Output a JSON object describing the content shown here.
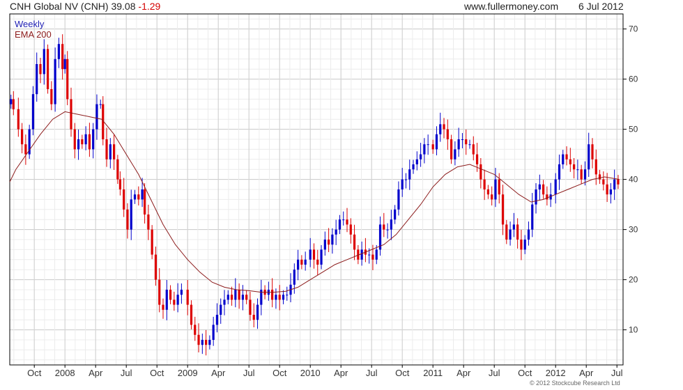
{
  "header": {
    "title": "CNH Global NV (CNH)",
    "last": "39.08",
    "change": "-1.29",
    "site": "www.fullermoney.com",
    "date": "6 Jul 2012"
  },
  "footer": {
    "copyright": "© 2012 Stockcube Research Ltd"
  },
  "colors": {
    "up": "#0000cc",
    "down": "#dd0000",
    "ema": "#8b1a1a",
    "grid": "#d6d6d6",
    "axis": "#000000"
  },
  "chart_data": {
    "type": "candlestick",
    "legend": [
      {
        "name": "Weekly",
        "color": "#1f1fb4"
      },
      {
        "name": "EMA 200",
        "color": "#8b1a1a"
      }
    ],
    "legend_position": "top-left",
    "yaxis_position": "right",
    "ylim": [
      3,
      73
    ],
    "yticks": [
      10,
      20,
      30,
      40,
      50,
      60,
      70
    ],
    "xlim": [
      2007.55,
      2012.55
    ],
    "xticks": [
      {
        "label": "Oct",
        "x": 2007.75
      },
      {
        "label": "2008",
        "x": 2008.0
      },
      {
        "label": "Apr",
        "x": 2008.25
      },
      {
        "label": "Jul",
        "x": 2008.5
      },
      {
        "label": "Oct",
        "x": 2008.75
      },
      {
        "label": "2009",
        "x": 2009.0
      },
      {
        "label": "Apr",
        "x": 2009.25
      },
      {
        "label": "Jul",
        "x": 2009.5
      },
      {
        "label": "Oct",
        "x": 2009.75
      },
      {
        "label": "2010",
        "x": 2010.0
      },
      {
        "label": "Apr",
        "x": 2010.25
      },
      {
        "label": "Jul",
        "x": 2010.5
      },
      {
        "label": "Oct",
        "x": 2010.75
      },
      {
        "label": "2011",
        "x": 2011.0
      },
      {
        "label": "Apr",
        "x": 2011.25
      },
      {
        "label": "Jul",
        "x": 2011.5
      },
      {
        "label": "Oct",
        "x": 2011.75
      },
      {
        "label": "2012",
        "x": 2012.0
      },
      {
        "label": "Apr",
        "x": 2012.25
      },
      {
        "label": "Jul",
        "x": 2012.5
      }
    ],
    "grid": true,
    "closes": [
      [
        2007.56,
        56
      ],
      [
        2007.58,
        54
      ],
      [
        2007.62,
        50
      ],
      [
        2007.65,
        47
      ],
      [
        2007.68,
        45
      ],
      [
        2007.71,
        50
      ],
      [
        2007.74,
        57
      ],
      [
        2007.77,
        63
      ],
      [
        2007.8,
        61
      ],
      [
        2007.83,
        66
      ],
      [
        2007.86,
        58
      ],
      [
        2007.89,
        55
      ],
      [
        2007.92,
        64
      ],
      [
        2007.95,
        67
      ],
      [
        2007.98,
        62
      ],
      [
        2008.0,
        64
      ],
      [
        2008.02,
        56
      ],
      [
        2008.05,
        50
      ],
      [
        2008.08,
        46
      ],
      [
        2008.11,
        48
      ],
      [
        2008.14,
        47
      ],
      [
        2008.17,
        49
      ],
      [
        2008.2,
        46
      ],
      [
        2008.23,
        50
      ],
      [
        2008.26,
        55
      ],
      [
        2008.29,
        55
      ],
      [
        2008.31,
        48
      ],
      [
        2008.34,
        44
      ],
      [
        2008.37,
        47
      ],
      [
        2008.4,
        44
      ],
      [
        2008.43,
        40
      ],
      [
        2008.45,
        38
      ],
      [
        2008.48,
        34
      ],
      [
        2008.51,
        30
      ],
      [
        2008.54,
        36
      ],
      [
        2008.57,
        37
      ],
      [
        2008.6,
        36
      ],
      [
        2008.63,
        38
      ],
      [
        2008.65,
        33
      ],
      [
        2008.68,
        30
      ],
      [
        2008.71,
        25
      ],
      [
        2008.74,
        20
      ],
      [
        2008.77,
        15
      ],
      [
        2008.8,
        14
      ],
      [
        2008.83,
        18
      ],
      [
        2008.86,
        16
      ],
      [
        2008.89,
        15
      ],
      [
        2008.92,
        17
      ],
      [
        2008.95,
        18
      ],
      [
        2009.0,
        15
      ],
      [
        2009.03,
        11
      ],
      [
        2009.06,
        9
      ],
      [
        2009.09,
        7
      ],
      [
        2009.12,
        8
      ],
      [
        2009.15,
        7
      ],
      [
        2009.18,
        8
      ],
      [
        2009.21,
        11
      ],
      [
        2009.24,
        13
      ],
      [
        2009.27,
        15
      ],
      [
        2009.3,
        16
      ],
      [
        2009.33,
        17
      ],
      [
        2009.36,
        16
      ],
      [
        2009.39,
        18
      ],
      [
        2009.42,
        16
      ],
      [
        2009.45,
        17
      ],
      [
        2009.48,
        16
      ],
      [
        2009.51,
        13
      ],
      [
        2009.54,
        12
      ],
      [
        2009.57,
        15
      ],
      [
        2009.6,
        18
      ],
      [
        2009.63,
        17
      ],
      [
        2009.66,
        18
      ],
      [
        2009.69,
        16
      ],
      [
        2009.72,
        17
      ],
      [
        2009.75,
        16
      ],
      [
        2009.78,
        17
      ],
      [
        2009.81,
        17
      ],
      [
        2009.84,
        19
      ],
      [
        2009.87,
        22
      ],
      [
        2009.9,
        24
      ],
      [
        2009.93,
        23
      ],
      [
        2009.96,
        24
      ],
      [
        2010.0,
        26
      ],
      [
        2010.03,
        24
      ],
      [
        2010.06,
        23
      ],
      [
        2010.09,
        26
      ],
      [
        2010.12,
        28
      ],
      [
        2010.15,
        27
      ],
      [
        2010.18,
        29
      ],
      [
        2010.21,
        30
      ],
      [
        2010.24,
        32
      ],
      [
        2010.27,
        32
      ],
      [
        2010.3,
        31
      ],
      [
        2010.33,
        29
      ],
      [
        2010.36,
        26
      ],
      [
        2010.39,
        24
      ],
      [
        2010.42,
        26
      ],
      [
        2010.45,
        25
      ],
      [
        2010.48,
        25
      ],
      [
        2010.51,
        24
      ],
      [
        2010.54,
        26
      ],
      [
        2010.57,
        31
      ],
      [
        2010.6,
        30
      ],
      [
        2010.63,
        30
      ],
      [
        2010.66,
        32
      ],
      [
        2010.69,
        34
      ],
      [
        2010.72,
        38
      ],
      [
        2010.75,
        40
      ],
      [
        2010.78,
        40
      ],
      [
        2010.81,
        42
      ],
      [
        2010.84,
        43
      ],
      [
        2010.87,
        44
      ],
      [
        2010.9,
        45
      ],
      [
        2010.93,
        47
      ],
      [
        2010.96,
        47
      ],
      [
        2011.0,
        46
      ],
      [
        2011.03,
        49
      ],
      [
        2011.06,
        51
      ],
      [
        2011.09,
        50
      ],
      [
        2011.12,
        48
      ],
      [
        2011.15,
        44
      ],
      [
        2011.18,
        46
      ],
      [
        2011.21,
        48
      ],
      [
        2011.24,
        48
      ],
      [
        2011.27,
        47
      ],
      [
        2011.3,
        47
      ],
      [
        2011.33,
        45
      ],
      [
        2011.36,
        43
      ],
      [
        2011.39,
        40
      ],
      [
        2011.42,
        38
      ],
      [
        2011.45,
        37
      ],
      [
        2011.48,
        36
      ],
      [
        2011.51,
        40
      ],
      [
        2011.54,
        37
      ],
      [
        2011.57,
        31
      ],
      [
        2011.6,
        28
      ],
      [
        2011.63,
        30
      ],
      [
        2011.66,
        31
      ],
      [
        2011.69,
        28
      ],
      [
        2011.72,
        26
      ],
      [
        2011.75,
        28
      ],
      [
        2011.78,
        30
      ],
      [
        2011.81,
        35
      ],
      [
        2011.84,
        38
      ],
      [
        2011.87,
        39
      ],
      [
        2011.9,
        37
      ],
      [
        2011.93,
        36
      ],
      [
        2011.96,
        37
      ],
      [
        2012.0,
        40
      ],
      [
        2012.03,
        43
      ],
      [
        2012.06,
        45
      ],
      [
        2012.09,
        44
      ],
      [
        2012.12,
        43
      ],
      [
        2012.15,
        42
      ],
      [
        2012.18,
        42
      ],
      [
        2012.21,
        40
      ],
      [
        2012.24,
        42
      ],
      [
        2012.27,
        47
      ],
      [
        2012.3,
        44
      ],
      [
        2012.33,
        41
      ],
      [
        2012.36,
        40
      ],
      [
        2012.39,
        39
      ],
      [
        2012.42,
        37
      ],
      [
        2012.45,
        38
      ],
      [
        2012.48,
        40
      ],
      [
        2012.51,
        39
      ]
    ],
    "ema_200": [
      [
        2007.55,
        39.5
      ],
      [
        2007.6,
        42
      ],
      [
        2007.7,
        45.5
      ],
      [
        2007.8,
        49
      ],
      [
        2007.9,
        52
      ],
      [
        2008.0,
        53.5
      ],
      [
        2008.1,
        53
      ],
      [
        2008.2,
        52.5
      ],
      [
        2008.3,
        52
      ],
      [
        2008.4,
        49
      ],
      [
        2008.5,
        45
      ],
      [
        2008.6,
        41
      ],
      [
        2008.7,
        36
      ],
      [
        2008.8,
        31
      ],
      [
        2008.9,
        27
      ],
      [
        2009.0,
        24
      ],
      [
        2009.1,
        21.5
      ],
      [
        2009.2,
        19.5
      ],
      [
        2009.3,
        18.5
      ],
      [
        2009.4,
        18
      ],
      [
        2009.5,
        17.8
      ],
      [
        2009.6,
        17.5
      ],
      [
        2009.7,
        17.5
      ],
      [
        2009.8,
        17.7
      ],
      [
        2009.9,
        18.5
      ],
      [
        2010.0,
        20
      ],
      [
        2010.1,
        21.5
      ],
      [
        2010.2,
        23
      ],
      [
        2010.3,
        24
      ],
      [
        2010.4,
        25
      ],
      [
        2010.5,
        26
      ],
      [
        2010.6,
        27
      ],
      [
        2010.7,
        29
      ],
      [
        2010.8,
        32
      ],
      [
        2010.9,
        35
      ],
      [
        2011.0,
        38.5
      ],
      [
        2011.1,
        41
      ],
      [
        2011.2,
        42.5
      ],
      [
        2011.3,
        43
      ],
      [
        2011.4,
        42
      ],
      [
        2011.5,
        41
      ],
      [
        2011.6,
        39
      ],
      [
        2011.7,
        37
      ],
      [
        2011.8,
        35.5
      ],
      [
        2011.9,
        36
      ],
      [
        2012.0,
        37
      ],
      [
        2012.1,
        38
      ],
      [
        2012.2,
        39
      ],
      [
        2012.3,
        40
      ],
      [
        2012.4,
        40.5
      ],
      [
        2012.52,
        40
      ]
    ]
  }
}
